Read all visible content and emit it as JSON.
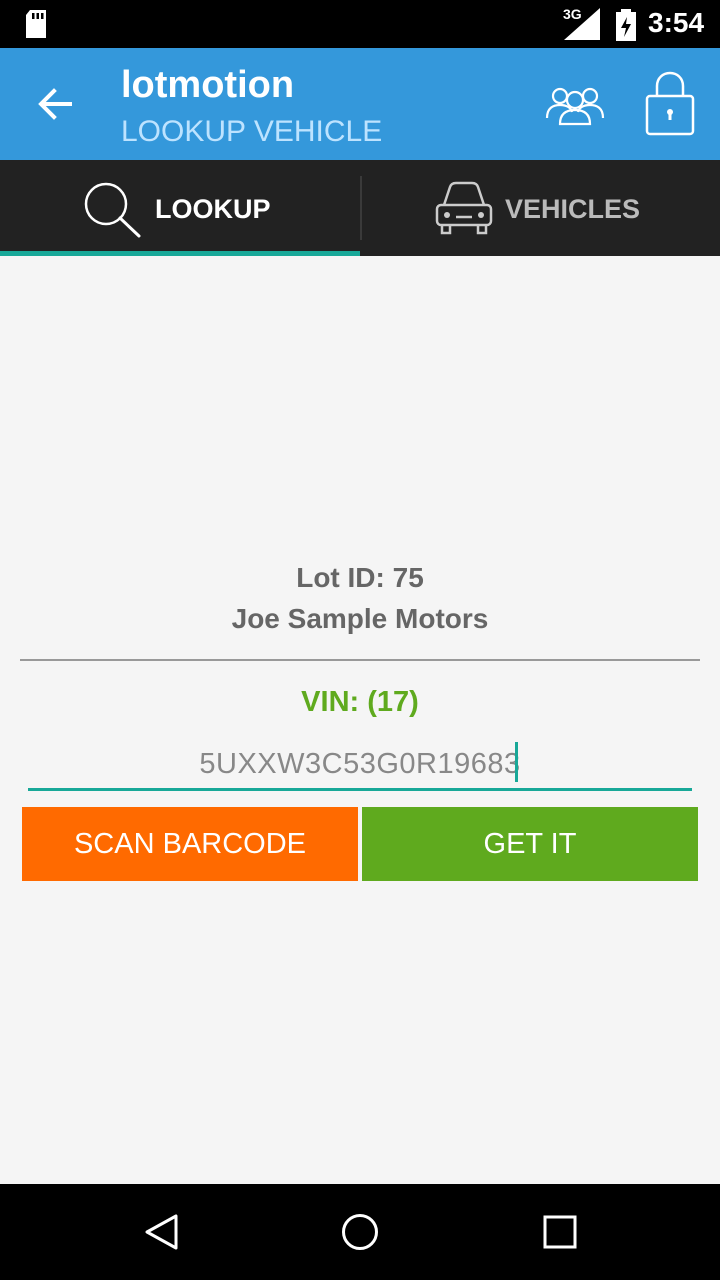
{
  "status_bar": {
    "time": "3:54",
    "network": "3G",
    "icons": [
      "sd-card-icon",
      "signal-icon",
      "battery-icon"
    ]
  },
  "app_bar": {
    "title": "lotmotion",
    "subtitle": "LOOKUP VEHICLE",
    "icons": [
      "back-arrow-icon",
      "users-icon",
      "lock-icon"
    ]
  },
  "tabs": [
    {
      "label": "LOOKUP",
      "icon": "search-icon",
      "selected": true
    },
    {
      "label": "VEHICLES",
      "icon": "car-icon",
      "selected": false
    }
  ],
  "lot": {
    "id_text": "Lot ID: 75",
    "dealer_name": "Joe Sample Motors"
  },
  "vin": {
    "label": "VIN: (17)",
    "value": "5UXXW3C53G0R19683"
  },
  "buttons": {
    "scan": "SCAN BARCODE",
    "get": "GET IT"
  },
  "nav_bar": {
    "icons": [
      "nav-back-icon",
      "nav-home-icon",
      "nav-recents-icon"
    ]
  },
  "colors": {
    "app_bar": "#3498db",
    "tab_bar": "#222222",
    "accent": "#18a898",
    "scan_button": "#ff6a00",
    "get_button": "#5faa1e",
    "vin_label": "#5faa1e"
  }
}
